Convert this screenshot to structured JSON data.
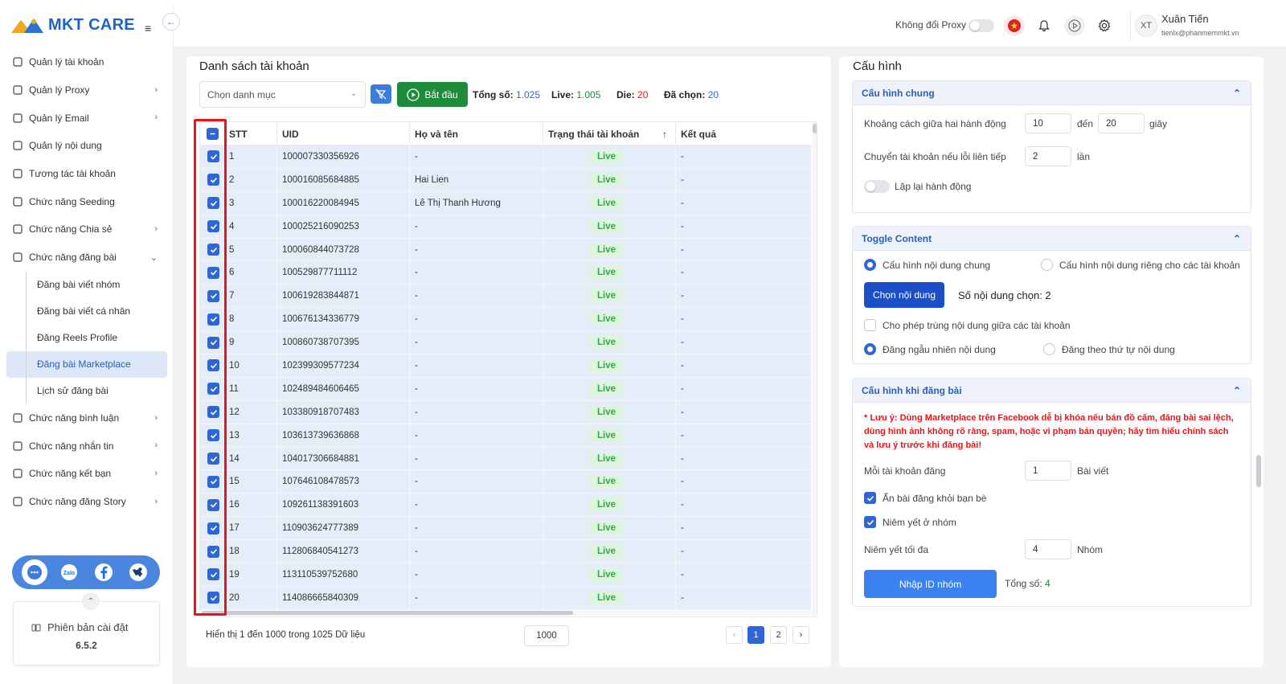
{
  "app": {
    "name": "MKT CARE"
  },
  "sidebar": {
    "items": [
      {
        "label": "Quản lý tài khoản",
        "icon": "grid-icon",
        "chevron": ""
      },
      {
        "label": "Quản lý Proxy",
        "icon": "layers-icon",
        "chevron": "›"
      },
      {
        "label": "Quản lý Email",
        "icon": "mail-icon",
        "chevron": "›"
      },
      {
        "label": "Quản lý nội dung",
        "icon": "content-icon",
        "chevron": ""
      },
      {
        "label": "Tương tác tài khoản",
        "icon": "interact-icon",
        "chevron": ""
      },
      {
        "label": "Chức năng Seeding",
        "icon": "seeding-icon",
        "chevron": ""
      },
      {
        "label": "Chức năng Chia sẻ",
        "icon": "share-icon",
        "chevron": "›"
      },
      {
        "label": "Chức năng đăng bài",
        "icon": "edit-icon",
        "chevron": "⌄"
      }
    ],
    "sub_items": [
      {
        "label": "Đăng bài viết nhóm"
      },
      {
        "label": "Đăng bài viết cá nhân"
      },
      {
        "label": "Đăng Reels Profile"
      },
      {
        "label": "Đăng bài Marketplace",
        "active": true
      },
      {
        "label": "Lịch sử đăng bài"
      }
    ],
    "items_after": [
      {
        "label": "Chức năng bình luận",
        "icon": "comment-icon",
        "chevron": "›"
      },
      {
        "label": "Chức năng nhắn tin",
        "icon": "chat-icon",
        "chevron": "›"
      },
      {
        "label": "Chức năng kết bạn",
        "icon": "add-friend-icon",
        "chevron": "›"
      },
      {
        "label": "Chức năng đăng Story",
        "icon": "story-icon",
        "chevron": "›"
      }
    ],
    "version_label": "Phiên bản cài đặt",
    "version": "6.5.2"
  },
  "header": {
    "proxy_label": "Không đổi Proxy",
    "user_initials": "XT",
    "user_name": "Xuân Tiến",
    "user_email": "tienlx@phanmemmkt.vn"
  },
  "accounts": {
    "title": "Danh sách tài khoản",
    "category_placeholder": "Chọn danh mục",
    "start_label": "Bắt đầu",
    "total_label": "Tổng số:",
    "total": "1.025",
    "live_label": "Live:",
    "live": "1.005",
    "die_label": "Die:",
    "die": "20",
    "selected_label": "Đã chọn:",
    "selected": "20",
    "columns": [
      "STT",
      "UID",
      "Họ và tên",
      "Trạng thái tài khoản",
      "Kết quả"
    ],
    "sort_icon": "↑",
    "rows": [
      {
        "stt": "1",
        "uid": "100007330356926",
        "name": "-",
        "status": "Live",
        "result": "-"
      },
      {
        "stt": "2",
        "uid": "100016085684885",
        "name": "Hai Lien",
        "status": "Live",
        "result": "-"
      },
      {
        "stt": "3",
        "uid": "100016220084945",
        "name": "Lê Thị Thanh Hương",
        "status": "Live",
        "result": "-"
      },
      {
        "stt": "4",
        "uid": "100025216090253",
        "name": "-",
        "status": "Live",
        "result": "-"
      },
      {
        "stt": "5",
        "uid": "100060844073728",
        "name": "-",
        "status": "Live",
        "result": "-"
      },
      {
        "stt": "6",
        "uid": "100529877711112",
        "name": "-",
        "status": "Live",
        "result": "-"
      },
      {
        "stt": "7",
        "uid": "100619283844871",
        "name": "-",
        "status": "Live",
        "result": "-"
      },
      {
        "stt": "8",
        "uid": "100676134336779",
        "name": "-",
        "status": "Live",
        "result": "-"
      },
      {
        "stt": "9",
        "uid": "100860738707395",
        "name": "-",
        "status": "Live",
        "result": "-"
      },
      {
        "stt": "10",
        "uid": "102399309577234",
        "name": "-",
        "status": "Live",
        "result": "-"
      },
      {
        "stt": "11",
        "uid": "102489484606465",
        "name": "-",
        "status": "Live",
        "result": "-"
      },
      {
        "stt": "12",
        "uid": "103380918707483",
        "name": "-",
        "status": "Live",
        "result": "-"
      },
      {
        "stt": "13",
        "uid": "103613739636868",
        "name": "-",
        "status": "Live",
        "result": "-"
      },
      {
        "stt": "14",
        "uid": "104017306684881",
        "name": "-",
        "status": "Live",
        "result": "-"
      },
      {
        "stt": "15",
        "uid": "107646108478573",
        "name": "-",
        "status": "Live",
        "result": "-"
      },
      {
        "stt": "16",
        "uid": "109261138391603",
        "name": "-",
        "status": "Live",
        "result": "-"
      },
      {
        "stt": "17",
        "uid": "110903624777389",
        "name": "-",
        "status": "Live",
        "result": "-"
      },
      {
        "stt": "18",
        "uid": "112806840541273",
        "name": "-",
        "status": "Live",
        "result": "-"
      },
      {
        "stt": "19",
        "uid": "113110539752680",
        "name": "-",
        "status": "Live",
        "result": "-"
      },
      {
        "stt": "20",
        "uid": "114086665840309",
        "name": "-",
        "status": "Live",
        "result": "-"
      }
    ],
    "footer_info": "Hiển thị 1 đến 1000 trong 1025 Dữ liệu",
    "page_size": "1000",
    "pages": [
      "1",
      "2"
    ],
    "prev": "‹",
    "next": "›"
  },
  "config": {
    "title": "Cấu hình",
    "general": {
      "title": "Cấu hình chung",
      "delay_label": "Khoảng cách giữa hai hành động",
      "delay_from": "10",
      "to_label": "đến",
      "delay_to": "20",
      "seconds_label": "giây",
      "switch_label": "Chuyển tài khoản nếu lỗi liên tiếp",
      "switch_value": "2",
      "times_label": "lần",
      "repeat_label": "Lặp lại hành động"
    },
    "toggle_content": {
      "title": "Toggle Content",
      "option_common": "Cấu hình nội dung chung",
      "option_private": "Cấu hình nội dung riêng cho các tài khoản",
      "choose_btn": "Chọn nội dung",
      "count_label": "Số nội dung chọn: 2",
      "allow_dup": "Cho phép trùng nội dung giữa các tài khoản",
      "random": "Đăng ngẫu nhiên nội dung",
      "ordered": "Đăng theo thứ tự nội dung"
    },
    "posting": {
      "title": "Cấu hình khi đăng bài",
      "warning": "* Lưu ý: Dùng Marketplace trên Facebook dễ bị khóa nếu bán đồ cấm, đăng bài sai lệch, dùng hình ảnh không rõ ràng, spam, hoặc vi phạm bản quyền; hãy tìm hiểu chính sách và lưu ý trước khi đăng bài!",
      "per_account_label": "Mỗi tài khoản đăng",
      "per_account": "1",
      "posts_label": "Bài viết",
      "hide_friends": "Ẩn bài đăng khỏi bạn bè",
      "list_in_groups": "Niêm yết ở nhóm",
      "max_label": "Niêm yết tối đa",
      "max_value": "4",
      "groups_label": "Nhóm",
      "import_btn": "Nhập ID nhóm",
      "total_label": "Tổng số:",
      "total": "4"
    }
  },
  "colors": {
    "accent": "#2f66d6",
    "start": "#1d8b3a",
    "live": "#31a84a",
    "die": "#e8141a",
    "highlight": "#e8141a"
  }
}
